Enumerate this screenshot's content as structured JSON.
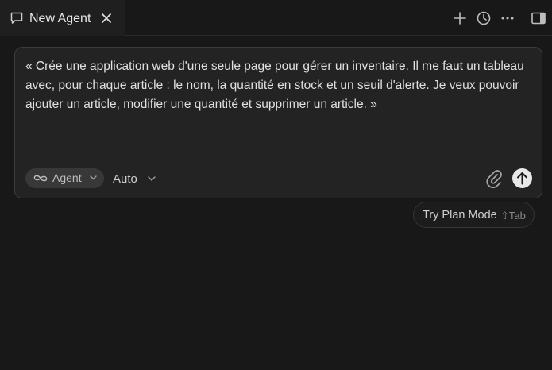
{
  "tab": {
    "title": "New Agent"
  },
  "composer": {
    "prompt": "« Crée une application web d'une seule page pour gérer un inventaire. Il me faut un tableau avec, pour chaque article : le nom, la quantité en stock et un seuil d'alerte. Je veux pouvoir ajouter un article, modifier une quantité et supprimer un article. »",
    "mode_label": "Agent",
    "model_label": "Auto"
  },
  "plan_mode": {
    "label": "Try Plan Mode",
    "shortcut": "⇧Tab"
  },
  "icons": {
    "tab": "chat-bubble-icon",
    "close": "close-icon",
    "new": "plus-icon",
    "history": "clock-icon",
    "more": "ellipsis-icon",
    "panel": "sidebar-toggle-icon",
    "mode": "infinity-icon",
    "attach": "paperclip-icon",
    "send": "arrow-up-icon"
  }
}
